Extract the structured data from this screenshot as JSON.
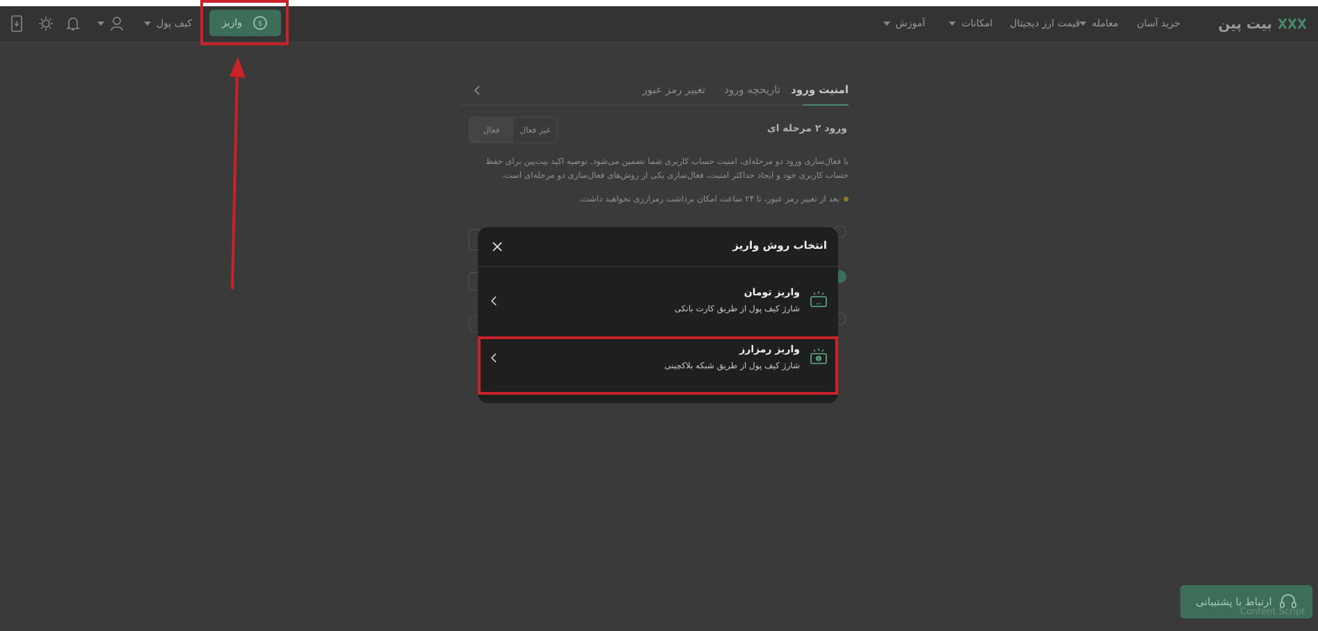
{
  "nav": {
    "logo": "بیت پین",
    "items": [
      {
        "label": "خرید آسان",
        "has_caret": false
      },
      {
        "label": "معامله",
        "has_caret": true
      },
      {
        "label": "قیمت ارز دیجیتال",
        "has_caret": false
      },
      {
        "label": "امکانات",
        "has_caret": true
      },
      {
        "label": "آموزش",
        "has_caret": true
      }
    ],
    "deposit_label": "واریز",
    "wallet_label": "کیف پول",
    "icons": [
      "user-icon",
      "bell-icon",
      "sun-icon",
      "mobile-app-icon"
    ]
  },
  "security": {
    "tabs": [
      "امنیت ورود",
      "تاریخچه ورود",
      "تغییر رمز عبور"
    ],
    "two_factor_title": "ورود ۲ مرحله ای",
    "toggle_off": "غیر فعال",
    "toggle_on": "فعال",
    "description": "با فعال‌سازی ورود دو مرحله‌ای، امنیت حساب کاربری شما تضمین می‌شود. توصیه اکید بیت‌پین برای حفظ حساب کاربری خود و ایجاد حداکثر امنیت، فعال‌سازی یکی از روش‌های فعال‌سازی دو مرحله‌ای است.",
    "warning": "بعد از تغییر رمز عبور، تا ۲۴ ساعت امکان برداشت رمزارزی نخواهید داشت."
  },
  "modal": {
    "title": "انتخاب روش واریز",
    "options": [
      {
        "title": "واریز تومان",
        "subtitle": "شارژ کیف پول از طریق کارت بانکی",
        "icon": "toman-deposit-icon"
      },
      {
        "title": "واریز رمزارز",
        "subtitle": "شارژ کیف پول از طریق شبکه بلاکچینی",
        "icon": "crypto-deposit-icon"
      }
    ]
  },
  "support": {
    "label": "ارتباط با پشتیبانی"
  },
  "overlay_text": "Content Script",
  "colors": {
    "accent": "#3d6e5a",
    "annotation_red": "#c8232a",
    "background": "#3a3a3a",
    "modal_bg": "#1f1f1f"
  }
}
